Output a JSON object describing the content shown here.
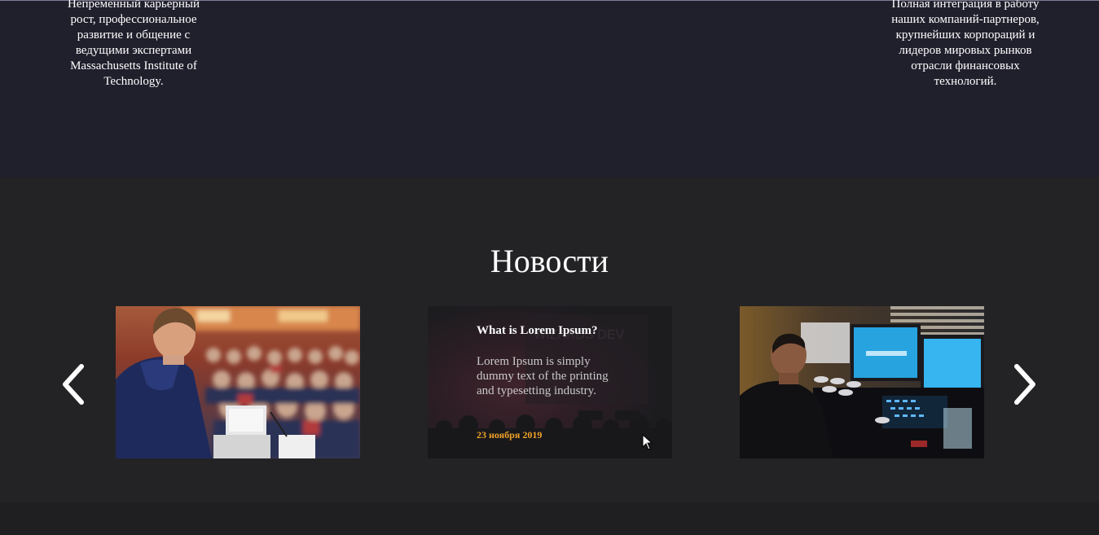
{
  "features": {
    "left_text": "Непременный карьерный рост, профессиональное развитие и общение с ведущими экспертами Massachusetts Institute of Technology.",
    "right_text": "Полная интеграция в работу наших компаний-партнеров, крупнейших корпораций и лидеров мировых рынков отрасли финансовых технологий."
  },
  "news": {
    "title": "Новости",
    "cards": [
      {
        "image": "conference-speaker-photo"
      },
      {
        "image": "event-stage-photo",
        "headline": "What is Lorem Ipsum?",
        "excerpt": "Lorem Ipsum is simply dummy text of the printing and typesetting industry.",
        "date": "23 ноября 2019",
        "watermark": "WIZARDS DEV"
      },
      {
        "image": "developer-workstation-photo"
      }
    ],
    "prev_icon": "chevron-left-icon",
    "next_icon": "chevron-right-icon"
  },
  "colors": {
    "top_band": "#201f2c",
    "section_bg": "#232325",
    "date_accent": "#f0a227",
    "text": "#ffffff"
  }
}
